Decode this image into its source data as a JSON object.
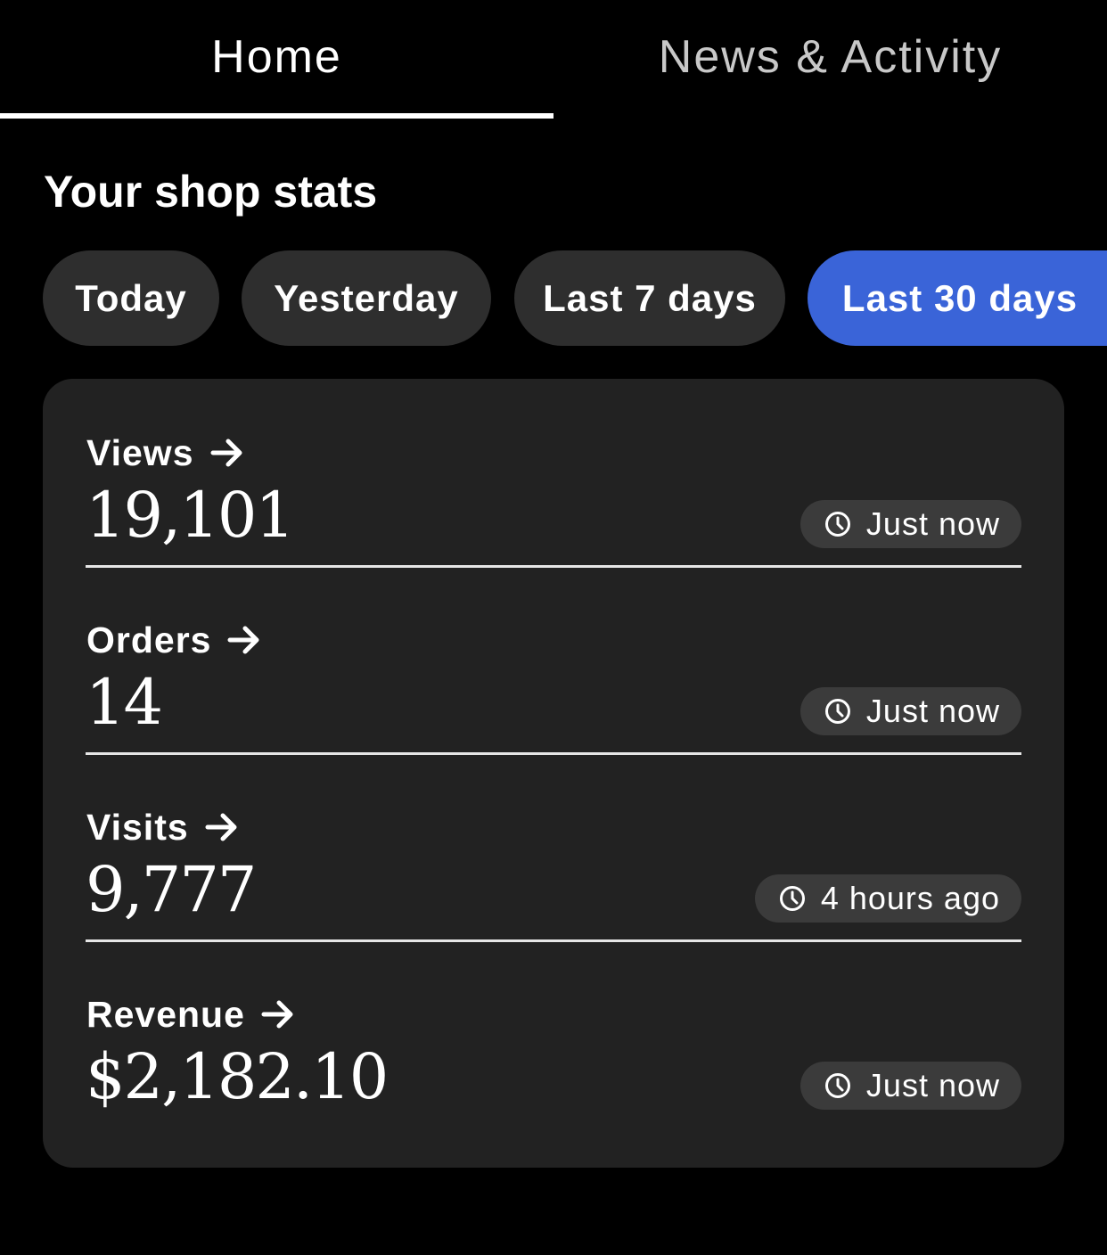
{
  "tabs": {
    "home": "Home",
    "news": "News & Activity",
    "active": "home"
  },
  "section": {
    "title": "Your shop stats"
  },
  "filters": {
    "options": [
      "Today",
      "Yesterday",
      "Last 7 days",
      "Last 30 days"
    ],
    "selected": "Last 30 days"
  },
  "stats": [
    {
      "label": "Views",
      "value": "19,101",
      "updated": "Just now"
    },
    {
      "label": "Orders",
      "value": "14",
      "updated": "Just now"
    },
    {
      "label": "Visits",
      "value": "9,777",
      "updated": "4 hours ago"
    },
    {
      "label": "Revenue",
      "value": "$2,182.10",
      "updated": "Just now"
    }
  ],
  "icons": {
    "label_arrow": "arrow-right-icon",
    "badge_clock": "clock-icon"
  },
  "colors": {
    "background": "#000000",
    "card": "#222222",
    "chip": "#2e2e2e",
    "chip_active": "#3a64d8",
    "badge": "#3b3b3b"
  }
}
